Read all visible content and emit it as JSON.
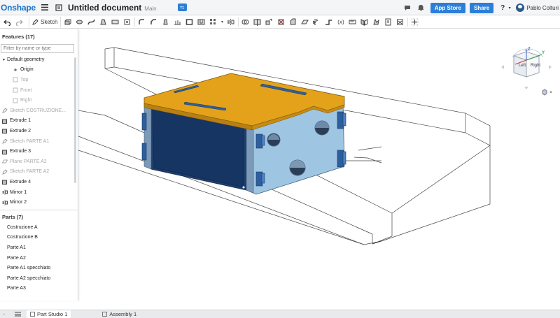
{
  "header": {
    "logo": "Onshape",
    "document_title": "Untitled document",
    "workspace": "Main",
    "app_store_label": "App Store",
    "share_label": "Share",
    "help_label": "?",
    "user_name": "Pablo Colturi"
  },
  "toolbar": {
    "sketch_label": "Sketch"
  },
  "features": {
    "header": "Features (17)",
    "filter_placeholder": "Filter by name or type",
    "items": [
      {
        "label": "Default geometry",
        "kind": "group"
      },
      {
        "label": "Origin",
        "kind": "origin"
      },
      {
        "label": "Top",
        "kind": "plane"
      },
      {
        "label": "Front",
        "kind": "plane"
      },
      {
        "label": "Right",
        "kind": "plane"
      },
      {
        "label": "Sketch COSTRUZIONE...",
        "kind": "sketch"
      },
      {
        "label": "Extrude 1",
        "kind": "extrude"
      },
      {
        "label": "Extrude 2",
        "kind": "extrude"
      },
      {
        "label": "Sketch PARTE A1",
        "kind": "sketch"
      },
      {
        "label": "Extrude 3",
        "kind": "extrude"
      },
      {
        "label": "Plane PARTE A2",
        "kind": "plane"
      },
      {
        "label": "Sketch PARTE A2",
        "kind": "sketch"
      },
      {
        "label": "Extrude 4",
        "kind": "extrude"
      },
      {
        "label": "Mirror 1",
        "kind": "mirror"
      },
      {
        "label": "Mirror 2",
        "kind": "mirror"
      }
    ]
  },
  "parts": {
    "header": "Parts (7)",
    "items": [
      "Costruzione A",
      "Costruzione B",
      "Parte A1",
      "Parte A2",
      "Parte A1 specchiato",
      "Parte A2 specchiato",
      "Parte A3"
    ]
  },
  "view_cube": {
    "left_label": "Left",
    "right_label": "Right",
    "axis_z": "Z",
    "axis_y": "Y"
  },
  "tabs": [
    {
      "label": "Part Studio 1",
      "active": true
    },
    {
      "label": "Assembly 1",
      "active": false
    }
  ],
  "colors": {
    "accent": "#2b7fd8",
    "top_panel": "#e3a21a",
    "side_panel": "#9ec5e2",
    "front_panel": "#1e3f6e",
    "clip": "#2d5f9e"
  }
}
